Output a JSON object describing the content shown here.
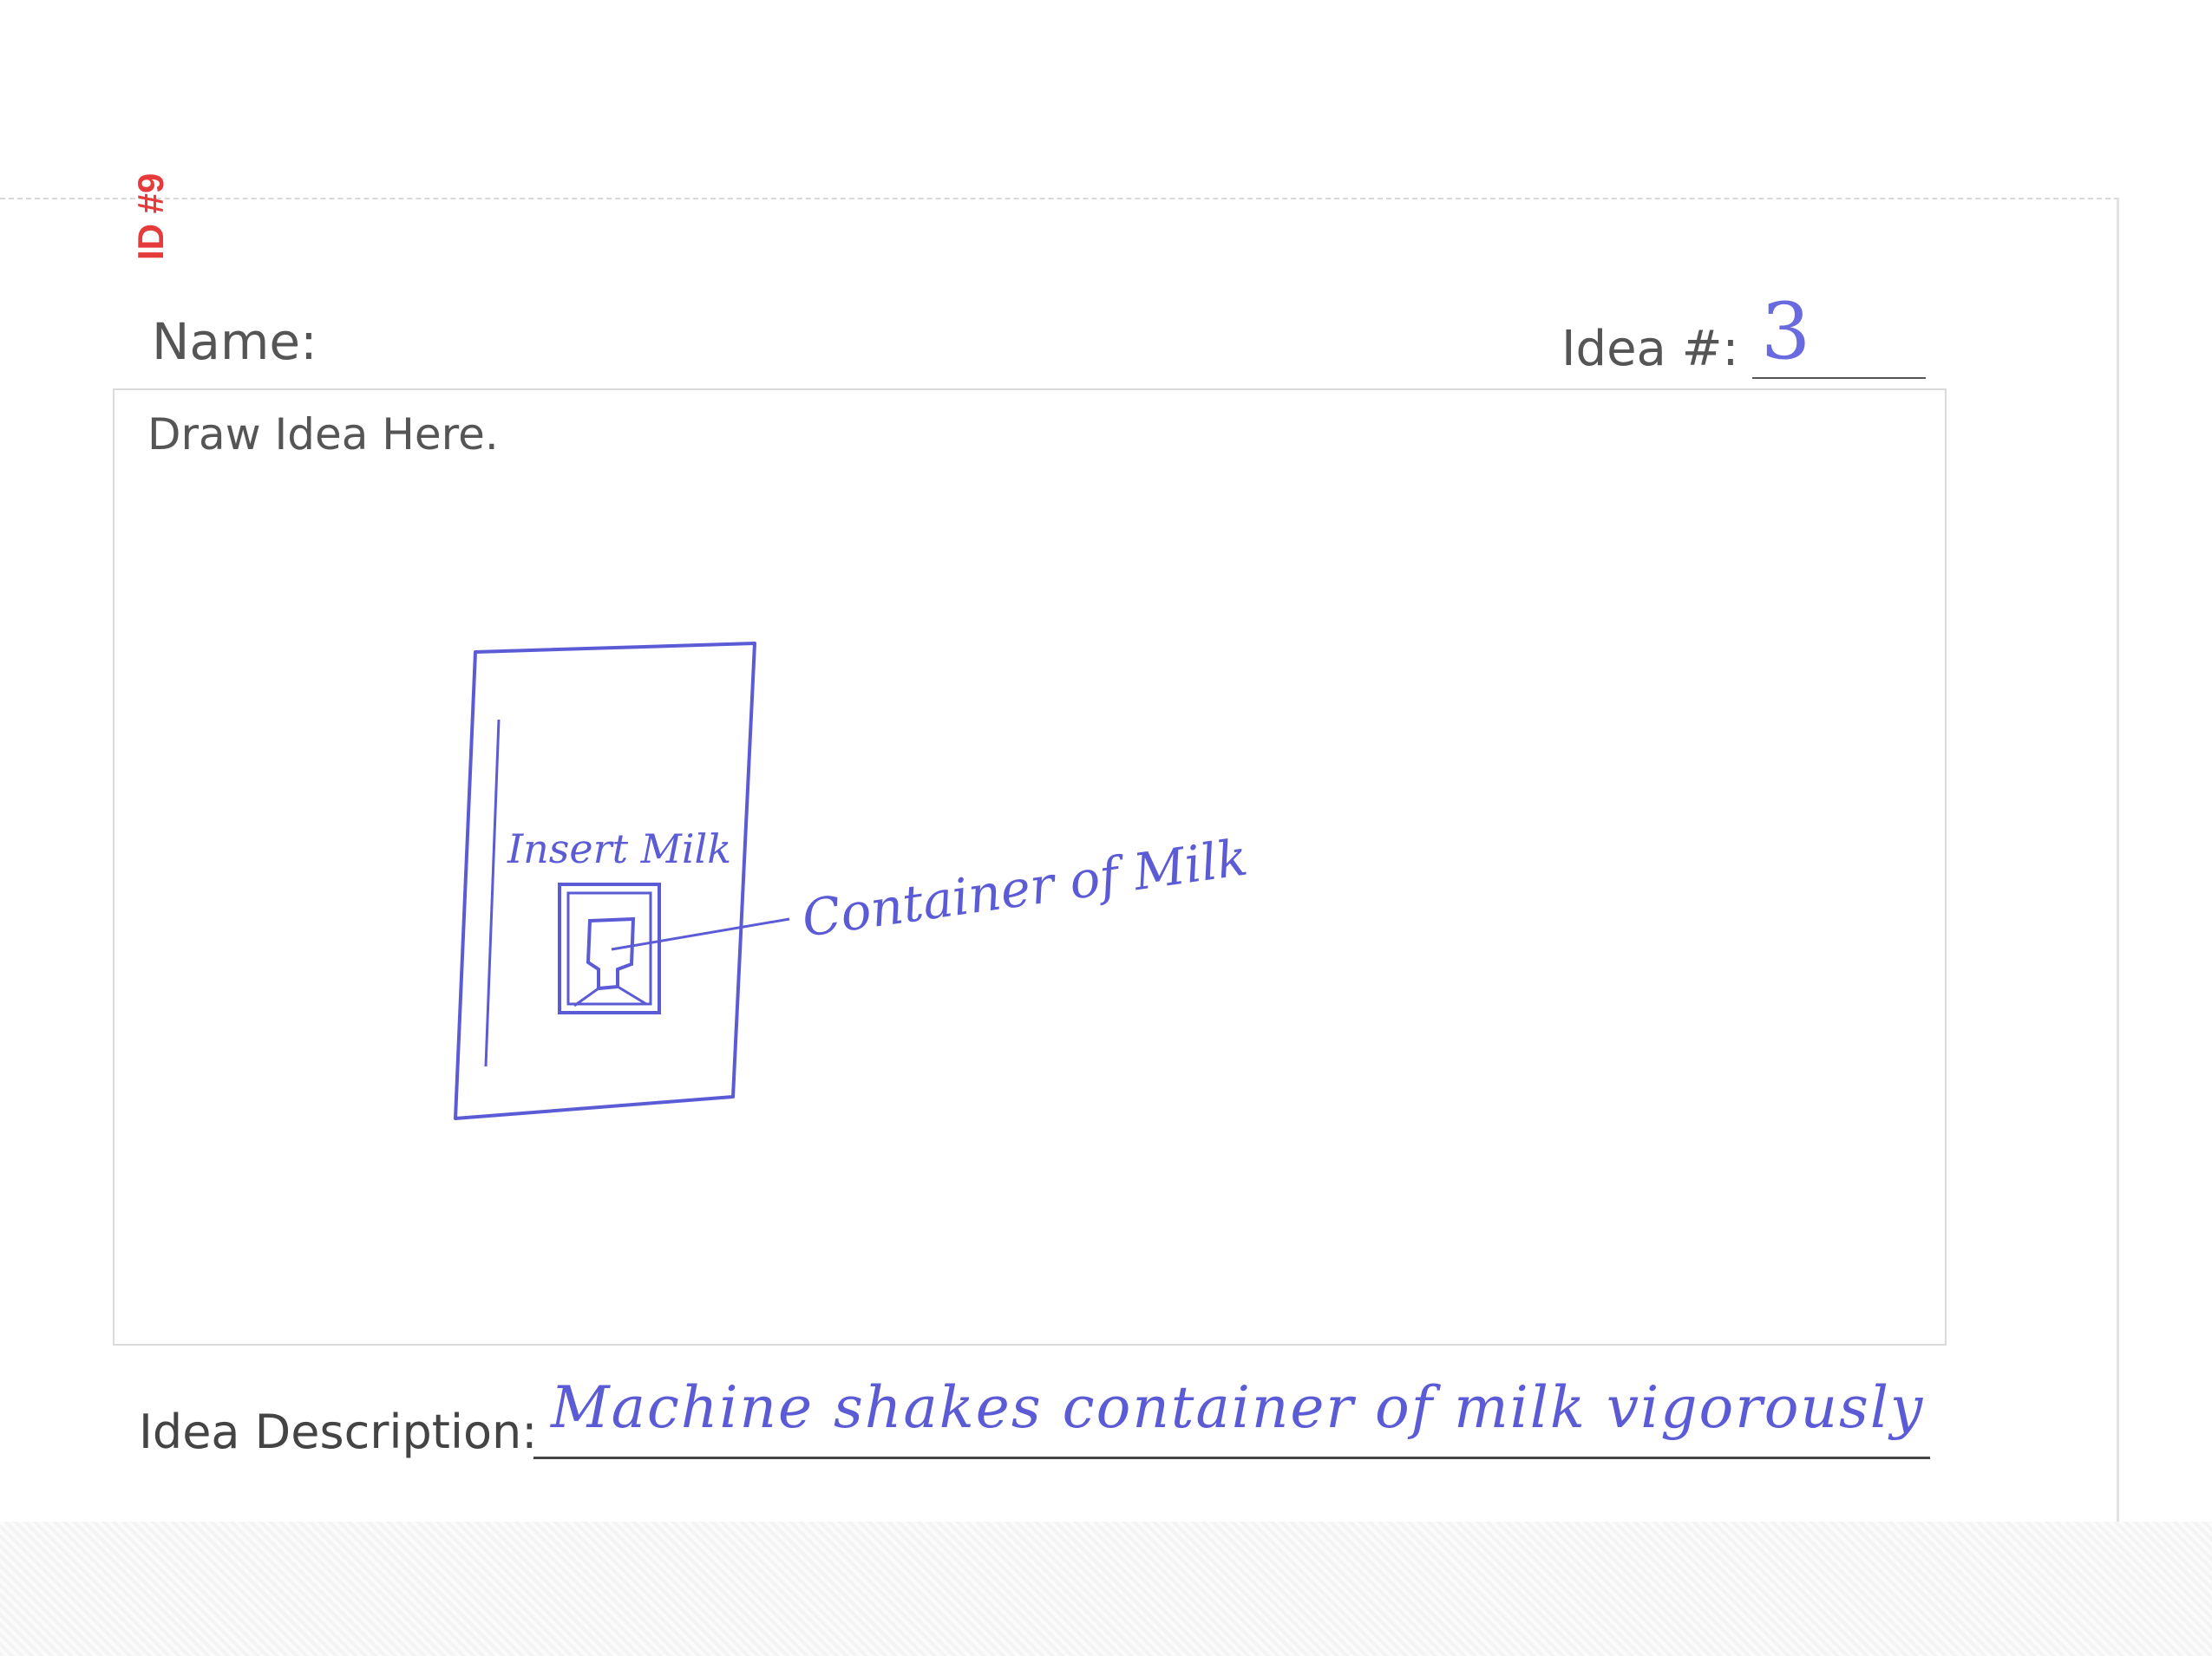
{
  "form": {
    "id_stamp": "ID #9",
    "name_label": "Name:",
    "idea_number_label": "Idea #:",
    "idea_number_value": "3",
    "draw_label": "Draw Idea Here.",
    "description_label": "Idea Description:",
    "description_value": "Machine shakes container of milk vigorously"
  },
  "sketch": {
    "inner_label": "Insert Milk",
    "callout_label": "Container of Milk"
  },
  "colors": {
    "ink": "#5b5bd6",
    "stamp": "#e53b3b",
    "printed_text": "#555555"
  }
}
